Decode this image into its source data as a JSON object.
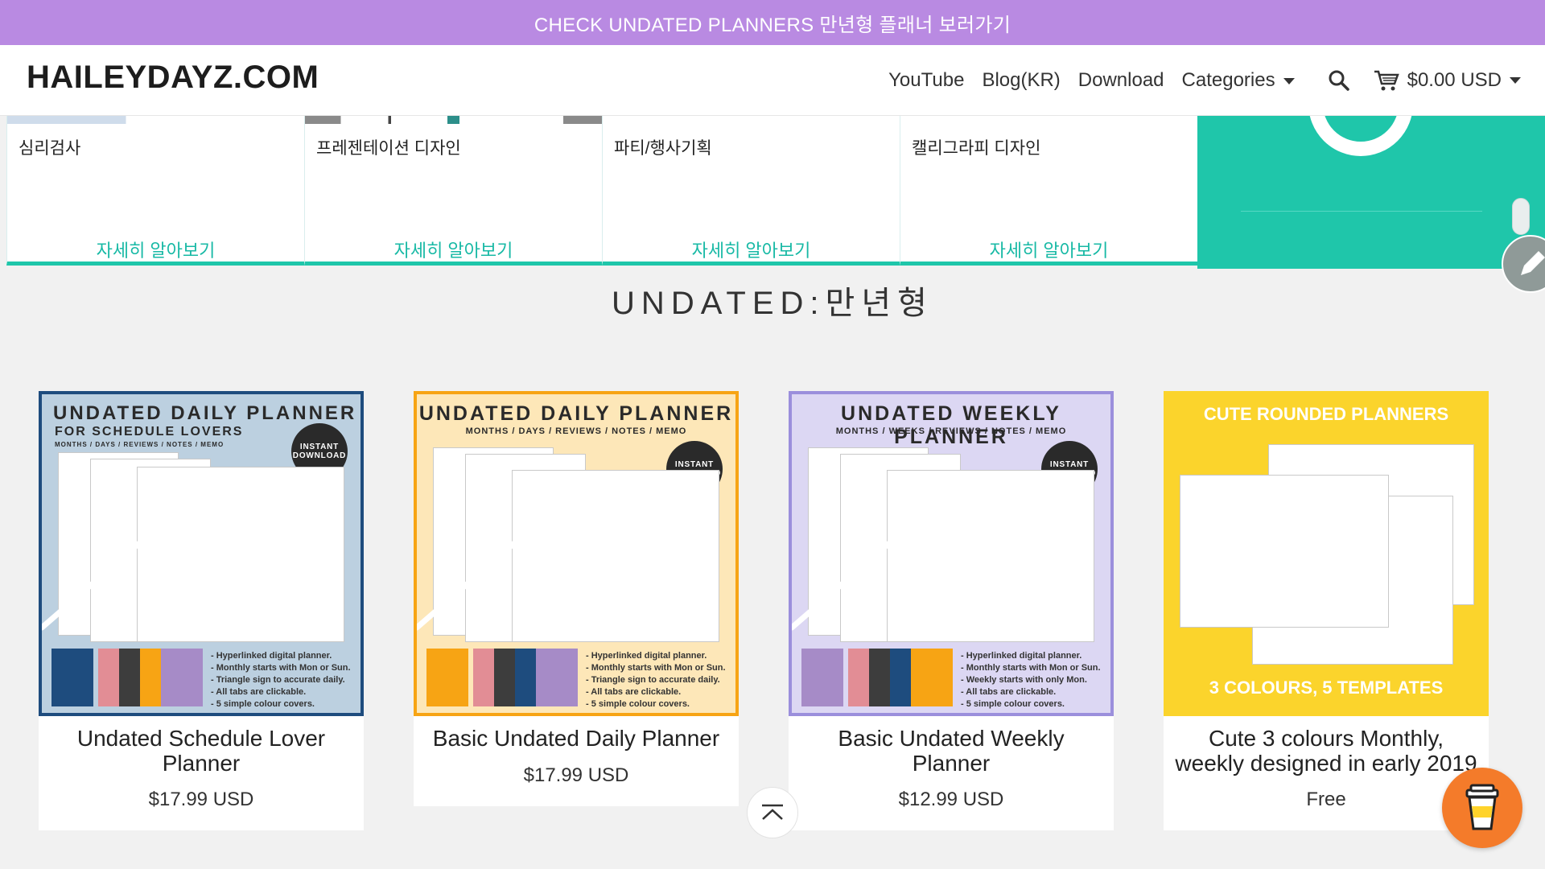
{
  "promo_banner": {
    "text": "CHECK UNDATED PLANNERS 만년형 플래너 보러가기"
  },
  "header": {
    "logo": "HAILEYDAYZ.COM",
    "nav": [
      "YouTube",
      "Blog(KR)",
      "Download",
      "Categories"
    ],
    "cart_total": "$0.00 USD"
  },
  "category_cards": [
    {
      "title": "심리검사",
      "link": "자세히 알아보기"
    },
    {
      "title": "프레젠테이션 디자인",
      "link": "자세히 알아보기"
    },
    {
      "title": "파티/행사기획",
      "link": "자세히 알아보기"
    },
    {
      "title": "캘리그라피 디자인",
      "link": "자세히 알아보기"
    }
  ],
  "section_title": "UNDATED:만년형",
  "products": [
    {
      "name": "Undated Schedule Lover Planner",
      "price": "$17.99 USD",
      "cover_title": "UNDATED DAILY PLANNER",
      "cover_subtitle": "FOR SCHEDULE LOVERS",
      "cover_tagline": "MONTHS / DAYS / REVIEWS / NOTES / MEMO",
      "badge": "INSTANT DOWNLOAD",
      "bullets": [
        "- Hyperlinked digital planner.",
        "- Monthly starts with Mon or Sun.",
        "- Triangle sign to accurate daily.",
        "- All tabs are clickable.",
        "- 5 simple colour covers."
      ],
      "bg": "#bcd0e0",
      "border": "#1e4c7e"
    },
    {
      "name": "Basic Undated Daily Planner",
      "price": "$17.99 USD",
      "cover_title": "UNDATED DAILY PLANNER",
      "cover_tagline": "MONTHS / DAYS / REVIEWS / NOTES / MEMO",
      "badge": "INSTANT DOWNLOAD",
      "bullets": [
        "- Hyperlinked digital planner.",
        "- Monthly starts with Mon or Sun.",
        "- Triangle sign to accurate daily.",
        "- All tabs are clickable.",
        "- 5 simple colour covers."
      ],
      "bg": "#fde7b8",
      "border": "#f7a414"
    },
    {
      "name": "Basic Undated Weekly Planner",
      "price": "$12.99 USD",
      "cover_title": "UNDATED WEEKLY PLANNER",
      "cover_tagline": "MONTHS / WEEKS / REVIEWS / NOTES / MEMO",
      "badge": "INSTANT DOWNLOAD",
      "bullets": [
        "- Hyperlinked digital planner.",
        "- Monthly starts with Mon or Sun.",
        "- Weekly starts with only Mon.",
        "- All tabs are clickable.",
        "- 5 simple colour covers."
      ],
      "bg": "#dcd7f3",
      "border": "#9b8fdc"
    },
    {
      "name": "Cute 3 colours Monthly, weekly designed in early 2019",
      "price": "Free",
      "cover_title": "CUTE ROUNDED PLANNERS",
      "cover_footer": "3 COLOURS, 5 TEMPLATES",
      "bg": "#fbd42c"
    }
  ],
  "colors": {
    "accent": "#1fc6aa",
    "promo": "#b98ae2",
    "coffee": "#f47b2a"
  }
}
